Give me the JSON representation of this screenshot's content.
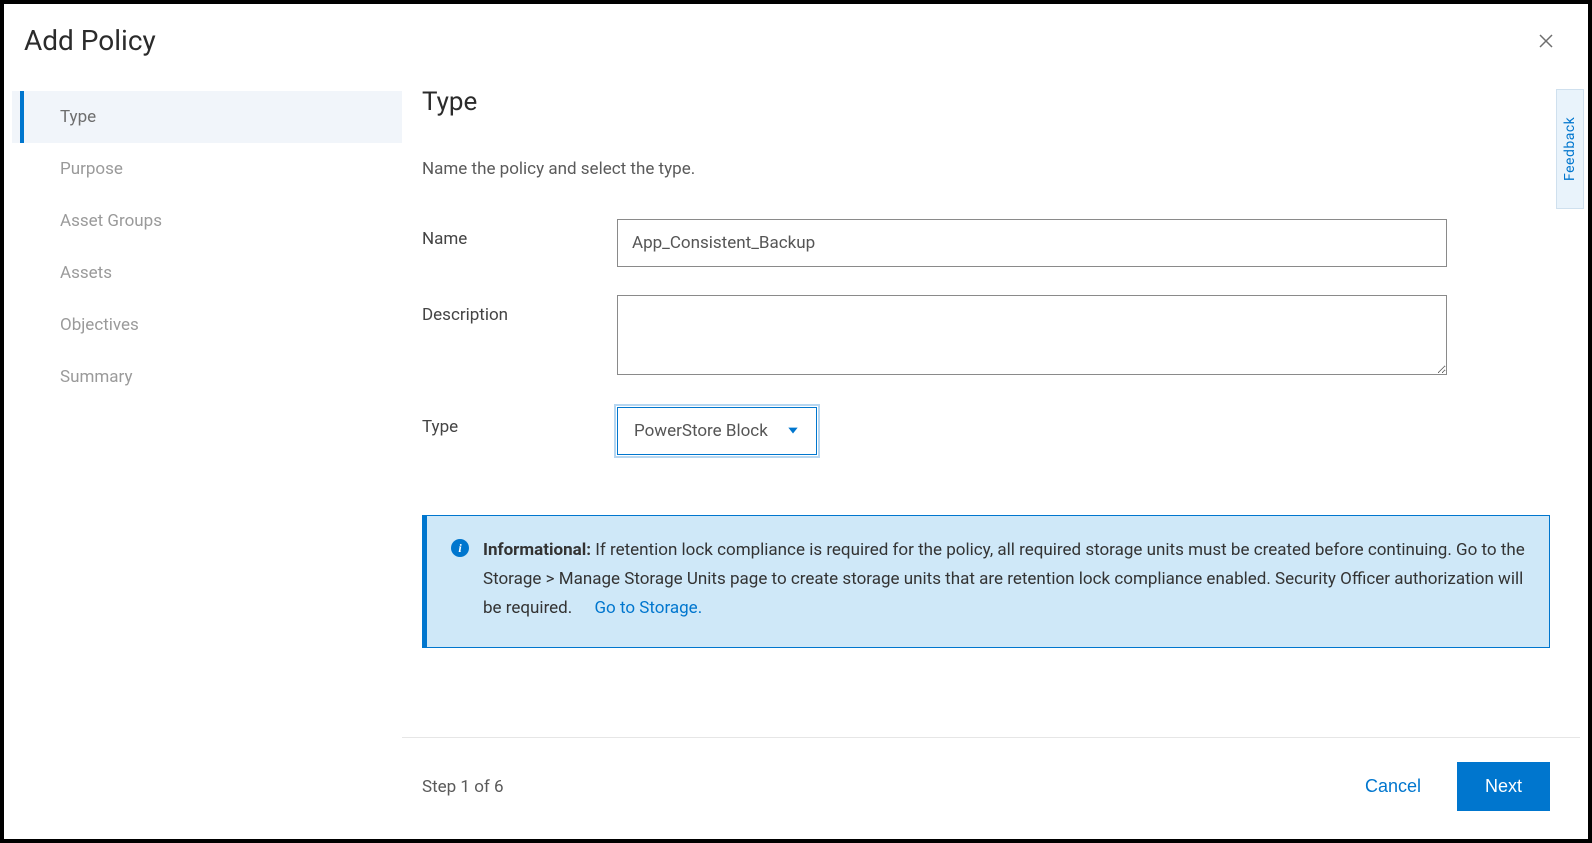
{
  "dialog": {
    "title": "Add Policy"
  },
  "sidebar": {
    "steps": [
      {
        "label": "Type",
        "active": true
      },
      {
        "label": "Purpose",
        "active": false
      },
      {
        "label": "Asset Groups",
        "active": false
      },
      {
        "label": "Assets",
        "active": false
      },
      {
        "label": "Objectives",
        "active": false
      },
      {
        "label": "Summary",
        "active": false
      }
    ]
  },
  "panel": {
    "title": "Type",
    "subtitle": "Name the policy and select the type.",
    "labels": {
      "name": "Name",
      "description": "Description",
      "type": "Type"
    },
    "fields": {
      "name_value": "App_Consistent_Backup",
      "description_value": "",
      "type_value": "PowerStore Block"
    }
  },
  "info": {
    "title": "Informational:",
    "body": "If retention lock compliance is required for the policy, all required storage units must be created before continuing. Go to the Storage > Manage Storage Units page to create storage units that are retention lock compliance enabled. Security Officer authorization will be required.",
    "link": "Go to Storage."
  },
  "footer": {
    "step_text": "Step 1 of 6",
    "cancel_label": "Cancel",
    "next_label": "Next"
  },
  "feedback": {
    "label": "Feedback"
  }
}
